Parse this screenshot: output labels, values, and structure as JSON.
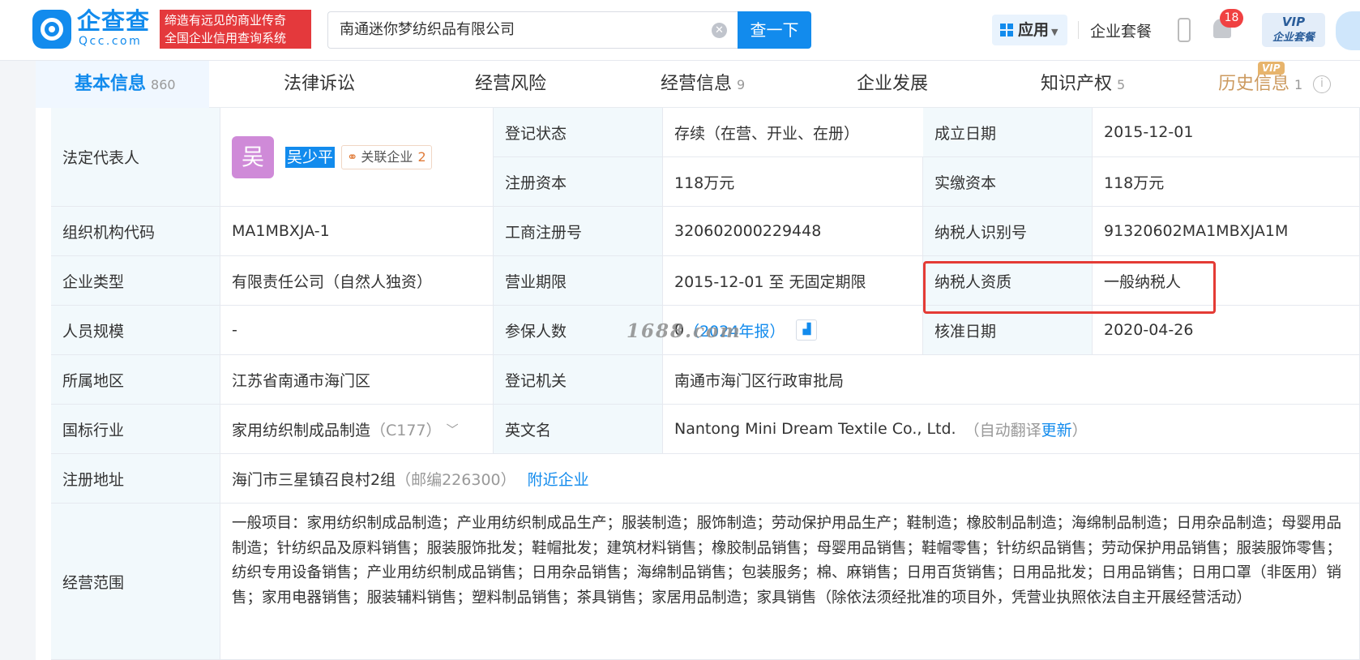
{
  "header": {
    "brand_cn": "企查查",
    "brand_en": "Qcc.com",
    "slogan": [
      "缔造有远见的商业传奇",
      "全国企业信用查询系统"
    ],
    "search_value": "南通迷你梦纺织品有限公司",
    "search_button": "查一下",
    "apps_label": "应用",
    "plan_label": "企业套餐",
    "notification_count": "18",
    "vip_label": "VIP",
    "vip_sub": "企业套餐"
  },
  "tabs": [
    {
      "label": "基本信息",
      "count": "860"
    },
    {
      "label": "法律诉讼",
      "count": ""
    },
    {
      "label": "经营风险",
      "count": ""
    },
    {
      "label": "经营信息",
      "count": "9"
    },
    {
      "label": "企业发展",
      "count": ""
    },
    {
      "label": "知识产权",
      "count": "5"
    },
    {
      "label": "历史信息",
      "count": "1",
      "tag": "VIP"
    }
  ],
  "info": {
    "legal_rep": {
      "label": "法定代表人",
      "avatar": "吴",
      "name": "吴少平",
      "related_label": "关联企业",
      "related_count": "2"
    },
    "reg_status": {
      "label": "登记状态",
      "value": "存续（在营、开业、在册）"
    },
    "founded": {
      "label": "成立日期",
      "value": "2015-12-01"
    },
    "reg_capital": {
      "label": "注册资本",
      "value": "118万元"
    },
    "paid_capital": {
      "label": "实缴资本",
      "value": "118万元"
    },
    "org_code": {
      "label": "组织机构代码",
      "value": "MA1MBXJA-1"
    },
    "biz_reg_no": {
      "label": "工商注册号",
      "value": "320602000229448"
    },
    "tax_id": {
      "label": "纳税人识别号",
      "value": "91320602MA1MBXJA1M"
    },
    "company_type": {
      "label": "企业类型",
      "value": "有限责任公司（自然人独资）"
    },
    "biz_term": {
      "label": "营业期限",
      "value": "2015-12-01 至 无固定期限"
    },
    "tax_qual": {
      "label": "纳税人资质",
      "value": "一般纳税人"
    },
    "staff_size": {
      "label": "人员规模",
      "value": "-"
    },
    "insured": {
      "label": "参保人数",
      "value": "0",
      "note": "（2024年报）"
    },
    "approval_date": {
      "label": "核准日期",
      "value": "2020-04-26"
    },
    "region": {
      "label": "所属地区",
      "value": "江苏省南通市海门区"
    },
    "reg_authority": {
      "label": "登记机关",
      "value": "南通市海门区行政审批局"
    },
    "industry": {
      "label": "国标行业",
      "value": "家用纺织制成品制造",
      "code": "（C177）"
    },
    "english_name": {
      "label": "英文名",
      "value": "Nantong Mini Dream Textile Co., Ltd.",
      "note_open": "（自动翻译",
      "note_link": "更新",
      "note_close": "）"
    },
    "address": {
      "label": "注册地址",
      "value": "海门市三星镇召良村2组",
      "postcode": "（邮编226300）",
      "nearby": "附近企业"
    },
    "scope": {
      "label": "经营范围",
      "value": "一般项目：家用纺织制成品制造；产业用纺织制成品生产；服装制造；服饰制造；劳动保护用品生产；鞋制造；橡胶制品制造；海绵制品制造；日用杂品制造；母婴用品制造；针纺织品及原料销售；服装服饰批发；鞋帽批发；建筑材料销售；橡胶制品销售；母婴用品销售；鞋帽零售；针纺织品销售；劳动保护用品销售；服装服饰零售；纺织专用设备销售；产业用纺织制成品销售；日用杂品销售；海绵制品销售；包装服务；棉、麻销售；日用百货销售；日用品批发；日用品销售；日用口罩（非医用）销售；家用电器销售；服装辅料销售；塑料制品销售；茶具销售；家居用品制造；家具销售（除依法须经批准的项目外，凭营业执照依法自主开展经营活动）"
    }
  },
  "watermark": "1688.com",
  "colors": {
    "primary": "#128bed",
    "label_bg": "#f2f9fc",
    "highlight_box": "#e43b35",
    "slogan_bg": "#e4393c"
  }
}
